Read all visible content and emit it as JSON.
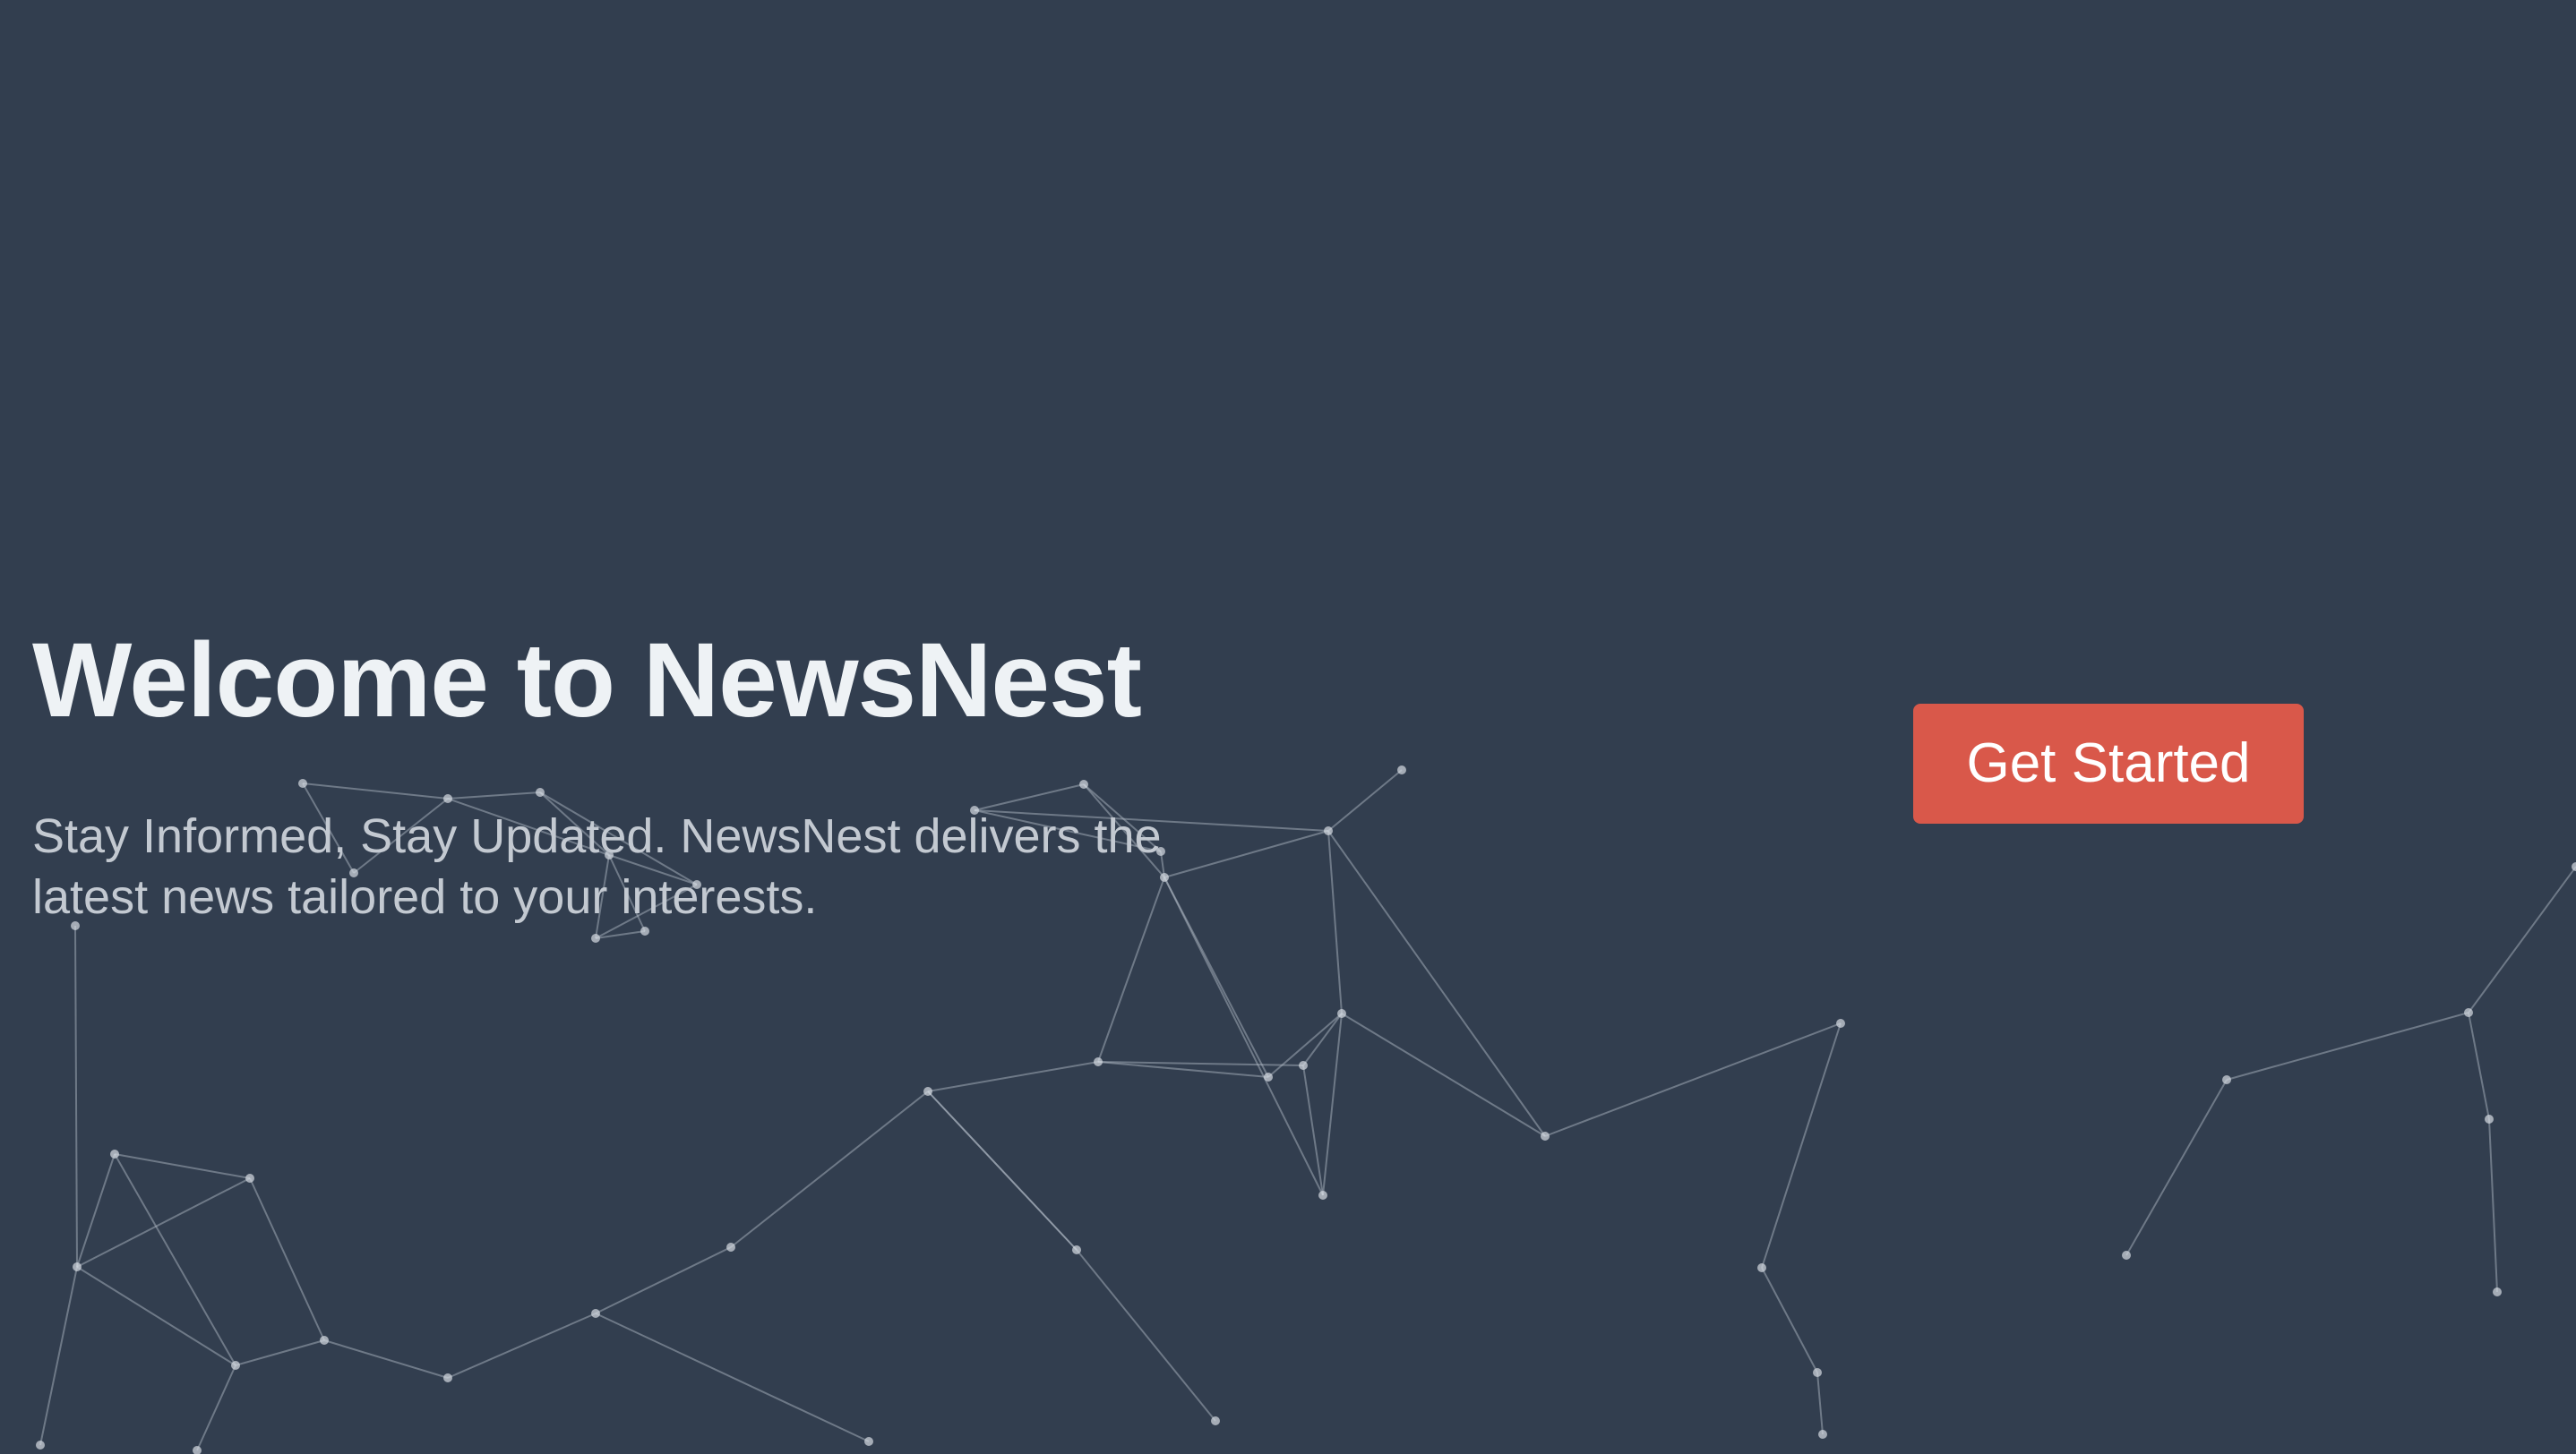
{
  "hero": {
    "title": "Welcome to NewsNest",
    "subtitle": "Stay Informed, Stay Updated. NewsNest delivers the latest news tailored to your interests.",
    "cta_label": "Get Started"
  },
  "colors": {
    "background": "#323e4f",
    "title": "#eef2f5",
    "subtitle": "#c3c9d1",
    "accent": "#d9584a",
    "network_line": "#b8c2cd",
    "network_node": "#d5dbe2"
  }
}
